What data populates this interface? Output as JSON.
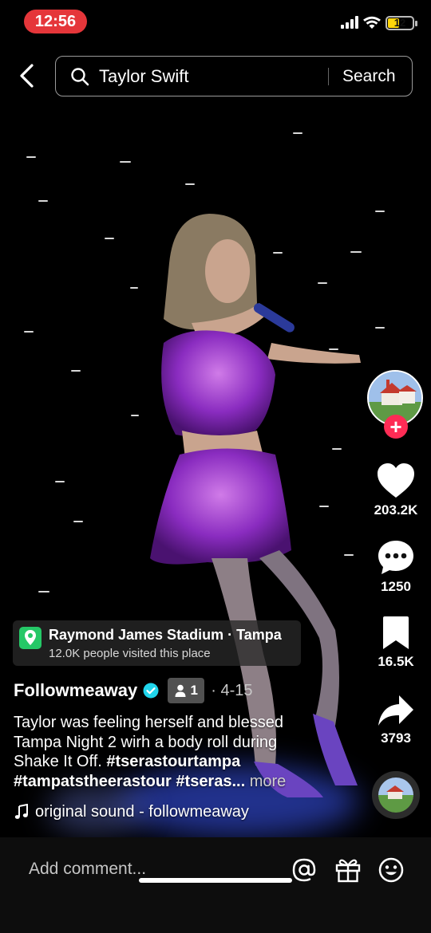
{
  "status_bar": {
    "time": "12:56",
    "battery": "12"
  },
  "search": {
    "query": "Taylor Swift",
    "button": "Search"
  },
  "actions": {
    "likes": "203.2K",
    "comments": "1250",
    "saves": "16.5K",
    "shares": "3793"
  },
  "location": {
    "title": "Raymond James Stadium · Tampa",
    "subtitle": "12.0K people visited this place"
  },
  "author": {
    "name": "Followmeaway",
    "friends_count": "1",
    "date": "· 4-15"
  },
  "caption": {
    "text": "Taylor was feeling herself and blessed Tampa Night 2 wirh a body roll during Shake It Off.",
    "hashtag1": "#tserastourtampa",
    "hashtag2": "#tampatstheerastour",
    "hashtag3": "#tseras...",
    "more": "more"
  },
  "sound": {
    "label": "original sound - followmeaway"
  },
  "comment_bar": {
    "placeholder": "Add comment..."
  },
  "colors": {
    "accent": "#fe2c55",
    "verified": "#20d5ec",
    "location_pin": "#25c867",
    "time_pill": "#e5363a"
  }
}
